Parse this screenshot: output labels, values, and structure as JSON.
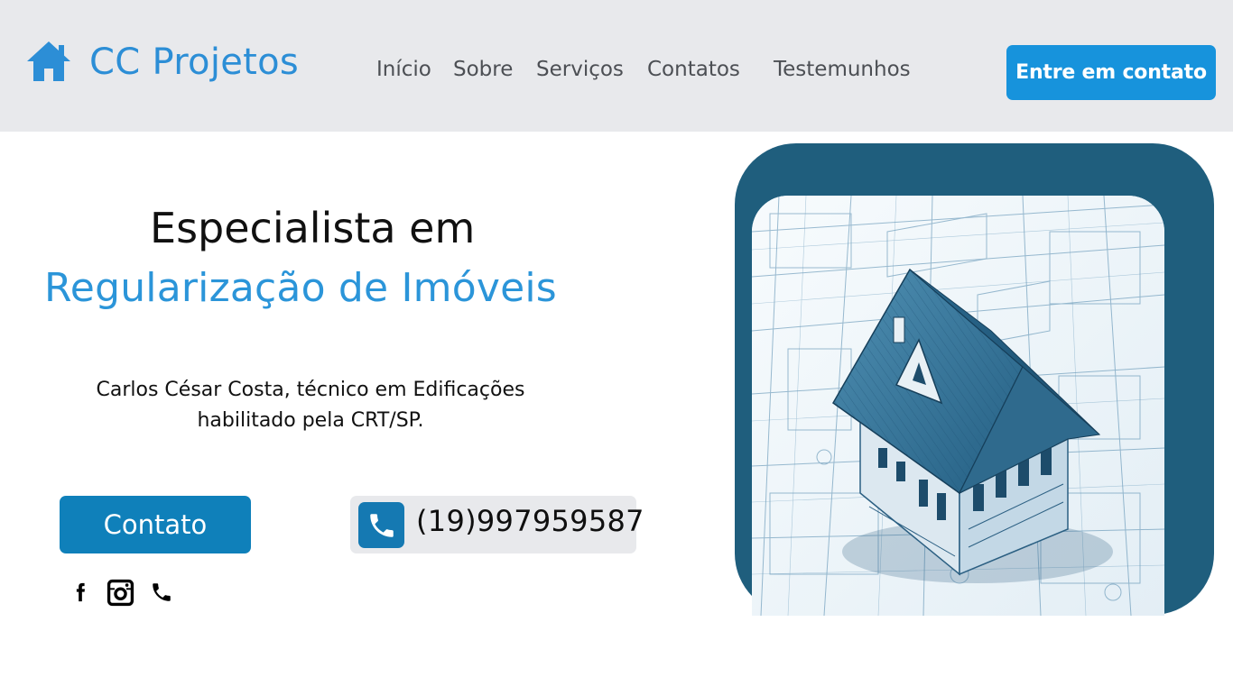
{
  "header": {
    "brand": "CC Projetos",
    "logo_icon": "home-icon",
    "nav": [
      {
        "label": "Início"
      },
      {
        "label": "Sobre"
      },
      {
        "label": "Serviços"
      },
      {
        "label": "Contatos"
      },
      {
        "label": "Testemunhos"
      }
    ],
    "cta_label": "Entre em contato"
  },
  "hero": {
    "title_line1": "Especialista em",
    "title_line2": "Regularização de Imóveis",
    "description": "Carlos César Costa, técnico em Edificações habilitado pela CRT/SP.",
    "contact_button": "Contato",
    "phone": "(19)997959587",
    "phone_icon": "phone-icon",
    "image_description_icon": "house-blueprint-image"
  },
  "social": {
    "icons": [
      "facebook-icon",
      "instagram-icon",
      "phone-icon"
    ]
  },
  "colors": {
    "header_bg": "#e8e9ec",
    "brand_blue": "#2c8ed6",
    "cta_blue": "#1793dc",
    "button_blue": "#0f80ba",
    "frame_blue": "#1f5e7d"
  }
}
